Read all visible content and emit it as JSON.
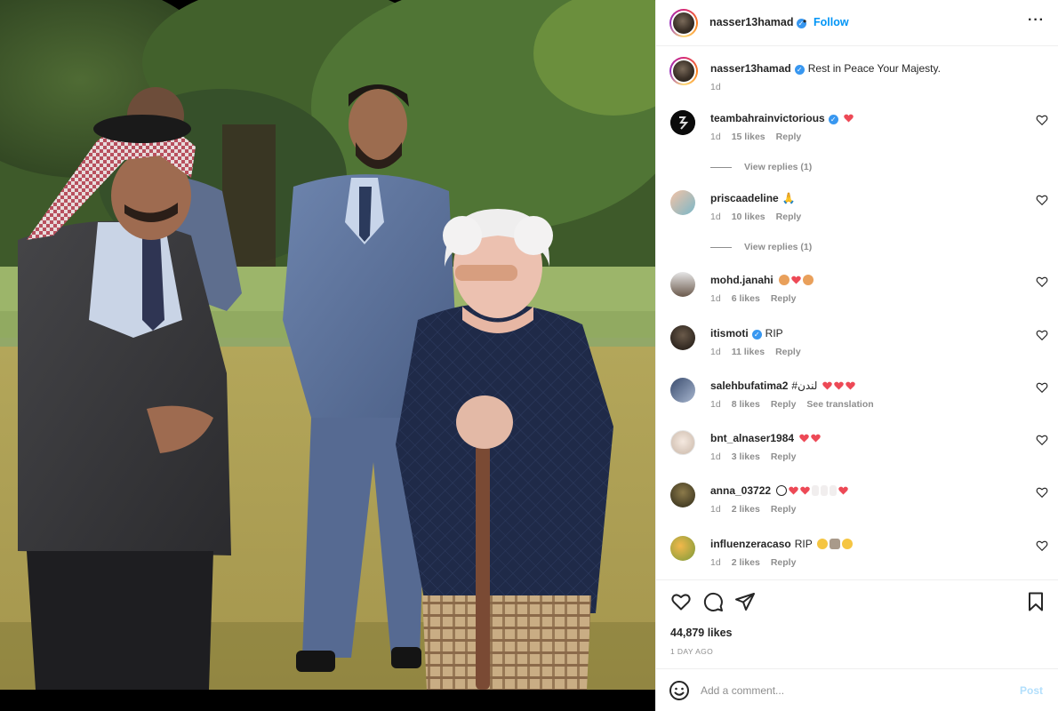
{
  "post": {
    "author": "nasser13hamad",
    "follow_label": "Follow",
    "dot": "•",
    "more_label": "···",
    "caption_text": "Rest in Peace Your Majesty.",
    "caption_time": "1d"
  },
  "comments": [
    {
      "user": "teambahrainvictorious",
      "verified": true,
      "text": "",
      "emoji": [
        "heart"
      ],
      "time": "1d",
      "likes": "15 likes",
      "reply": "Reply",
      "view_replies": "View replies (1)"
    },
    {
      "user": "priscaadeline",
      "verified": false,
      "text": "🙏",
      "emoji": [],
      "time": "1d",
      "likes": "10 likes",
      "reply": "Reply",
      "view_replies": "View replies (1)"
    },
    {
      "user": "mohd.janahi",
      "verified": false,
      "text": "",
      "emoji": [
        "face",
        "heart",
        "face"
      ],
      "time": "1d",
      "likes": "6 likes",
      "reply": "Reply"
    },
    {
      "user": "itismoti",
      "verified": true,
      "text": "RIP",
      "emoji": [],
      "time": "1d",
      "likes": "11 likes",
      "reply": "Reply"
    },
    {
      "user": "salehbufatima2",
      "verified": false,
      "text": "#لندن",
      "emoji": [
        "heart",
        "heart",
        "heart"
      ],
      "time": "1d",
      "likes": "8 likes",
      "reply": "Reply",
      "see_translation": "See translation"
    },
    {
      "user": "bnt_alnaser1984",
      "verified": false,
      "text": "",
      "emoji": [
        "heart",
        "heart"
      ],
      "time": "1d",
      "likes": "3 likes",
      "reply": "Reply"
    },
    {
      "user": "anna_03722",
      "verified": false,
      "text": "",
      "emoji": [
        "clock",
        "heart",
        "heart",
        "hand",
        "hand",
        "hand",
        "heart"
      ],
      "time": "1d",
      "likes": "2 likes",
      "reply": "Reply"
    },
    {
      "user": "influenzeracaso",
      "verified": false,
      "text": "RIP",
      "emoji": [
        "sad",
        "pray",
        "sad"
      ],
      "time": "1d",
      "likes": "2 likes",
      "reply": "Reply"
    }
  ],
  "actions": {
    "likes_count": "44,879 likes",
    "posted_ago": "1 DAY AGO"
  },
  "composer": {
    "placeholder": "Add a comment...",
    "post_label": "Post"
  },
  "colors": {
    "accent": "#0095f6",
    "verified": "#3897f0",
    "heart_red": "#ed4956",
    "muted": "#8e8e8e",
    "post_disabled": "#b2dffc"
  },
  "icons": {
    "like": "heart-outline-icon",
    "comment": "speech-bubble-icon",
    "share": "paper-plane-icon",
    "save": "bookmark-icon",
    "emoji": "smiley-icon",
    "more": "ellipsis-icon"
  }
}
